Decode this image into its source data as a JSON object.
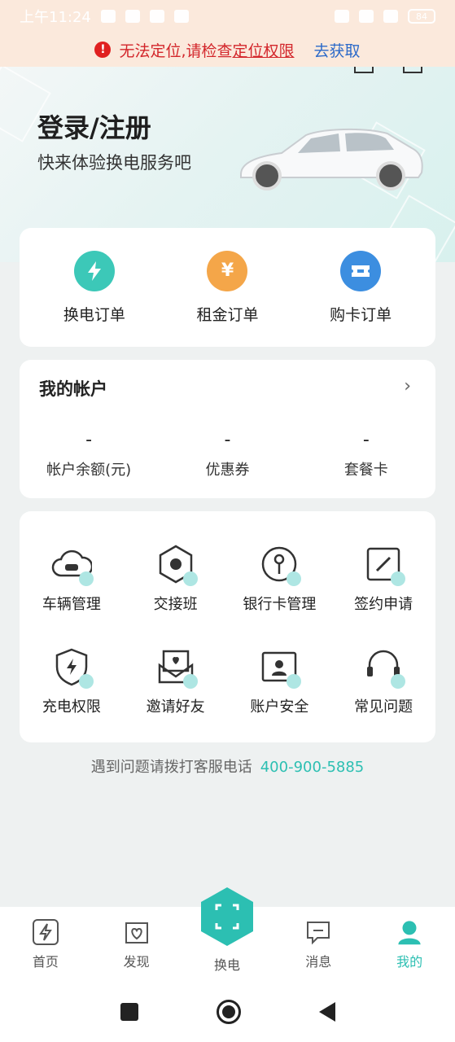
{
  "status_bar": {
    "time": "上午11:24",
    "battery": "84"
  },
  "location_warning": {
    "message_prefix": "无法定位,请检查",
    "message_link": "定位权限",
    "action": "去获取"
  },
  "hero": {
    "title": "登录/注册",
    "subtitle": "快来体验换电服务吧"
  },
  "orders": [
    {
      "label": "换电订单",
      "icon": "lightning-icon",
      "color": "#3cc8b8"
    },
    {
      "label": "租金订单",
      "icon": "yen-icon",
      "color": "#f4a649"
    },
    {
      "label": "购卡订单",
      "icon": "ticket-icon",
      "color": "#3c8ee0"
    }
  ],
  "account": {
    "title": "我的帐户",
    "items": [
      {
        "value": "-",
        "label": "帐户余额(元)"
      },
      {
        "value": "-",
        "label": "优惠券"
      },
      {
        "value": "-",
        "label": "套餐卡"
      }
    ]
  },
  "services": [
    {
      "label": "车辆管理",
      "icon": "car-cloud-icon"
    },
    {
      "label": "交接班",
      "icon": "hexagon-handover-icon"
    },
    {
      "label": "银行卡管理",
      "icon": "bank-card-icon"
    },
    {
      "label": "签约申请",
      "icon": "sign-edit-icon"
    },
    {
      "label": "充电权限",
      "icon": "shield-lightning-icon"
    },
    {
      "label": "邀请好友",
      "icon": "invite-envelope-icon"
    },
    {
      "label": "账户安全",
      "icon": "account-security-icon"
    },
    {
      "label": "常见问题",
      "icon": "headset-icon"
    }
  ],
  "hotline": {
    "text": "遇到问题请拨打客服电话",
    "phone": "400-900-5885"
  },
  "bottom_nav": {
    "items": [
      {
        "label": "首页",
        "icon": "home-lightning-icon"
      },
      {
        "label": "发现",
        "icon": "discover-heart-icon"
      },
      {
        "label": "换电",
        "icon": "scan-icon"
      },
      {
        "label": "消息",
        "icon": "message-icon"
      },
      {
        "label": "我的",
        "icon": "profile-icon"
      }
    ],
    "active": "我的"
  },
  "colors": {
    "accent": "#2cbfb2",
    "warning_bg": "#fbe9dc",
    "warning_text": "#d3262b",
    "link_blue": "#2b69c9"
  }
}
